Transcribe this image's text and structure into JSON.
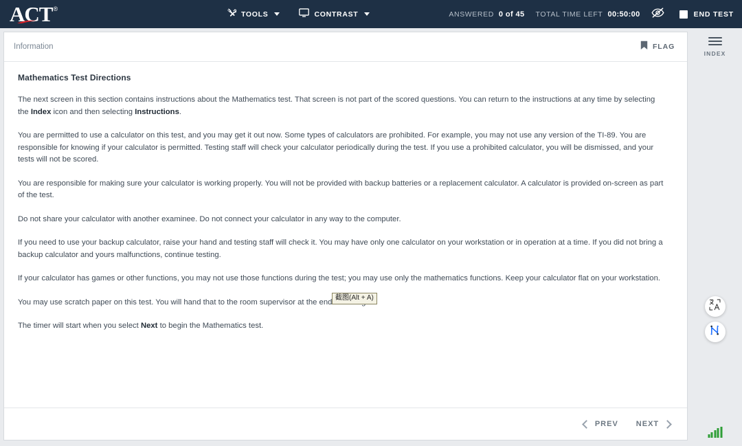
{
  "header": {
    "logo_text": "ACT",
    "logo_registered": "®",
    "tools_label": "TOOLS",
    "contrast_label": "CONTRAST",
    "answered_label": "ANSWERED",
    "answered_value": "0 of 45",
    "time_label": "TOTAL TIME LEFT",
    "time_value": "00:50:00",
    "hide_timer_icon": "eye-slash-icon",
    "end_test_label": "END TEST",
    "tools_icon": "tools-icon",
    "contrast_icon": "monitor-icon",
    "colors": {
      "header_bg": "#1e3045",
      "accent_red": "#d8232a",
      "signal_green": "#2f9e37",
      "node_blue": "#1e6fff"
    }
  },
  "info_bar": {
    "title": "Information",
    "flag_label": "FLAG",
    "flag_icon": "bookmark-flag-icon"
  },
  "passage": {
    "heading": "Mathematics Test Directions",
    "paragraphs": [
      {
        "parts": [
          {
            "text": "The next screen in this section contains instructions about the Mathematics test. That screen is not part of the scored questions. You can return to the instructions at any time by selecting the ",
            "bold": false
          },
          {
            "text": "Index",
            "bold": true
          },
          {
            "text": " icon and then selecting ",
            "bold": false
          },
          {
            "text": "Instructions",
            "bold": true
          },
          {
            "text": ".",
            "bold": false
          }
        ]
      },
      {
        "parts": [
          {
            "text": "You are permitted to use a calculator on this test, and you may get it out now. Some types of calculators are prohibited. For example, you may not use any version of the TI-89. You are responsible for knowing if your calculator is permitted. Testing staff will check your calculator periodically during the test. If you use a prohibited calculator, you will be dismissed, and your tests will not be scored.",
            "bold": false
          }
        ]
      },
      {
        "parts": [
          {
            "text": "You are responsible for making sure your calculator is working properly. You will not be provided with backup batteries or a replacement calculator. A calculator is provided on-screen as part of the test.",
            "bold": false
          }
        ]
      },
      {
        "parts": [
          {
            "text": "Do not share your calculator with another examinee. Do not connect your calculator in any way to the computer.",
            "bold": false
          }
        ]
      },
      {
        "parts": [
          {
            "text": "If you need to use your backup calculator, raise your hand and testing staff will check it. You may have only one calculator on your workstation or in operation at a time. If you did not bring a backup calculator and yours malfunctions, continue testing.",
            "bold": false
          }
        ]
      },
      {
        "parts": [
          {
            "text": "If your calculator has games or other functions, you may not use those functions during the test; you may use only the mathematics functions. Keep your calculator flat on your workstation.",
            "bold": false
          }
        ]
      },
      {
        "parts": [
          {
            "text": "You may use scratch paper on this test. You will hand that to the room supervisor at the end of testing.",
            "bold": false
          }
        ]
      },
      {
        "parts": [
          {
            "text": "The timer will start when you select ",
            "bold": false
          },
          {
            "text": "Next",
            "bold": true
          },
          {
            "text": " to begin the Mathematics test.",
            "bold": false
          }
        ]
      }
    ]
  },
  "screenshot_tooltip": {
    "label": "截图(Alt + A)"
  },
  "footer": {
    "prev_label": "PREV",
    "next_label": "NEXT"
  },
  "rail": {
    "index_label": "INDEX",
    "index_icon": "hamburger-menu-icon",
    "translate_icon": "translate-icon",
    "network_icon": "network-nodes-icon",
    "signal_icon": "signal-bars-icon"
  }
}
